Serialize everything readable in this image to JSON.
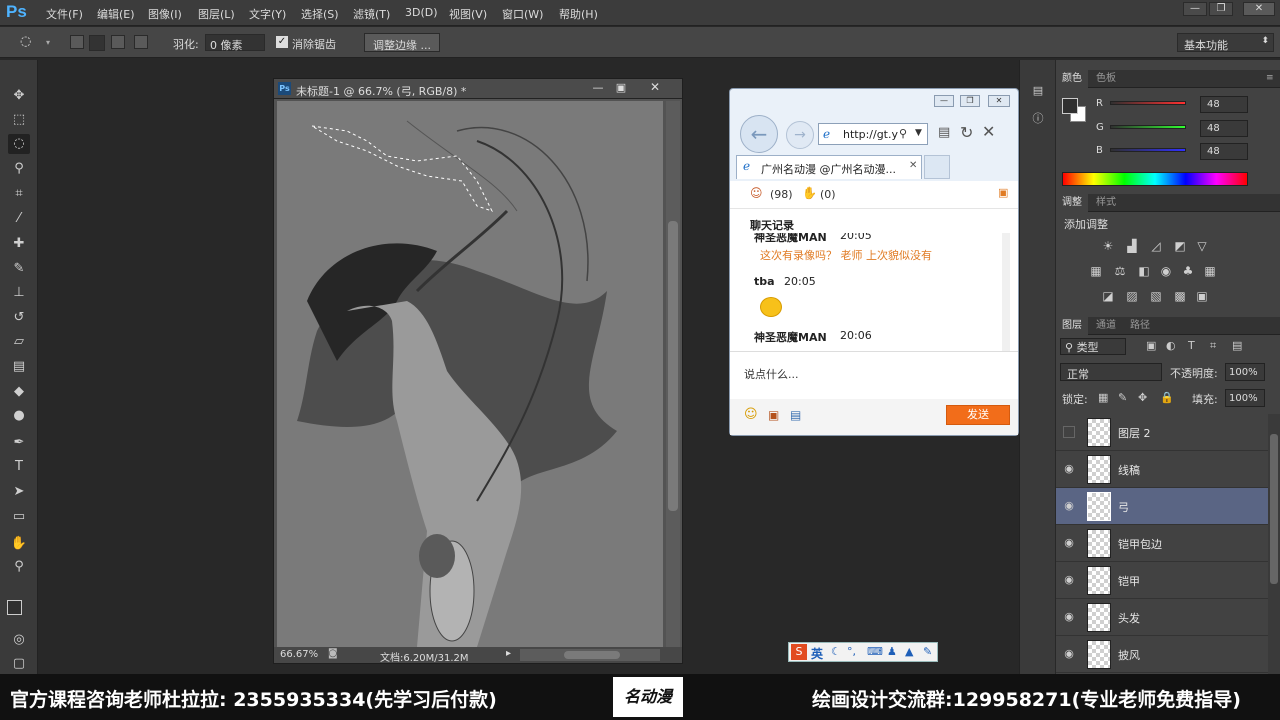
{
  "app": {
    "logo": "Ps",
    "menu": [
      "文件(F)",
      "编辑(E)",
      "图像(I)",
      "图层(L)",
      "文字(Y)",
      "选择(S)",
      "滤镜(T)",
      "3D(D)",
      "视图(V)",
      "窗口(W)",
      "帮助(H)"
    ],
    "window_buttons": [
      "—",
      "❐",
      "✕"
    ]
  },
  "options": {
    "feather_label": "羽化:",
    "feather_value": "0 像素",
    "antialias_label": "消除锯齿",
    "refine_edge": "调整边缘 ...",
    "workspace": "基本功能"
  },
  "document": {
    "title": "未标题-1 @ 66.7% (弓, RGB/8) *",
    "zoom": "66.67%",
    "doc_size": "文档:6.20M/31.2M"
  },
  "chat": {
    "address": "http://gt.y",
    "tab_title": "广州名动漫 @广州名动漫...",
    "online_count": "(98)",
    "hand_count": "(0)",
    "history_title": "聊天记录",
    "messages": [
      {
        "user": "神圣恶魔MAN",
        "time": "20:05",
        "text": "这次有录像吗？ 老师 上次貌似没有"
      },
      {
        "user": "tba",
        "time": "20:05",
        "text": ""
      },
      {
        "user": "神圣恶魔MAN",
        "time": "20:06",
        "text": ""
      }
    ],
    "input_placeholder": "说点什么...",
    "send_label": "发送"
  },
  "panels": {
    "color_tabs": [
      "颜色",
      "色板"
    ],
    "rgb": [
      {
        "label": "R",
        "value": "48"
      },
      {
        "label": "G",
        "value": "48"
      },
      {
        "label": "B",
        "value": "48"
      }
    ],
    "adjust_tabs": [
      "调整",
      "样式"
    ],
    "adjust_title": "添加调整",
    "layer_tabs": [
      "图层",
      "通道",
      "路径"
    ],
    "filter_kind": "类型",
    "blend_mode": "正常",
    "opacity_label": "不透明度:",
    "opacity_value": "100%",
    "lock_label": "锁定:",
    "fill_label": "填充:",
    "fill_value": "100%",
    "layers": [
      {
        "name": "图层 2",
        "visible": false,
        "selected": false
      },
      {
        "name": "线稿",
        "visible": true,
        "selected": false
      },
      {
        "name": "弓",
        "visible": true,
        "selected": true
      },
      {
        "name": "铠甲包边",
        "visible": true,
        "selected": false
      },
      {
        "name": "铠甲",
        "visible": true,
        "selected": false
      },
      {
        "name": "头发",
        "visible": true,
        "selected": false
      },
      {
        "name": "披风",
        "visible": true,
        "selected": false
      }
    ]
  },
  "ime": {
    "label": "英"
  },
  "banner": {
    "left": "官方课程咨询老师杜拉拉: 2355935334(先学习后付款)",
    "logo": "名动漫",
    "right": "绘画设计交流群:129958271(专业老师免费指导)"
  }
}
